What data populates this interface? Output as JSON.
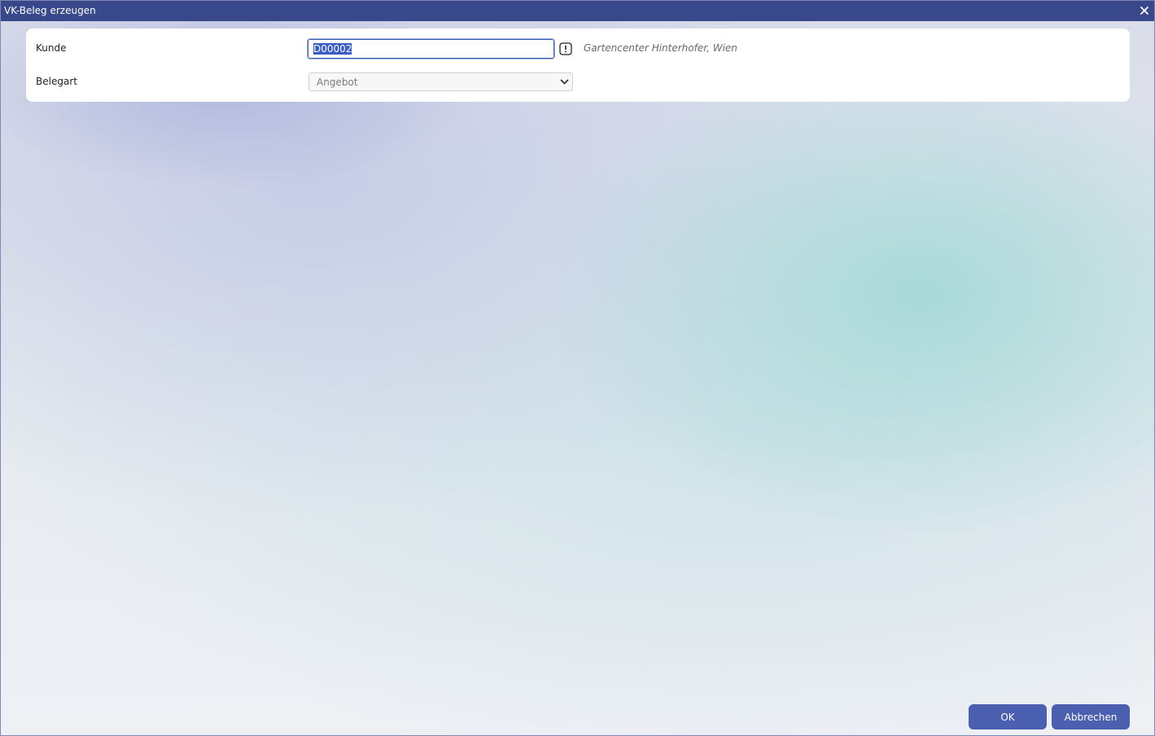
{
  "window": {
    "title": "VK-Beleg erzeugen",
    "close_label": "✕"
  },
  "form": {
    "kunde": {
      "label": "Kunde",
      "value": "D00002",
      "customer_name": "Gartencenter Hinterhofer, Wien",
      "warning_icon": "exclamation-icon"
    },
    "belegart": {
      "label": "Belegart",
      "selected": "Angebot"
    }
  },
  "buttons": {
    "ok": "OK",
    "cancel": "Abbrechen"
  },
  "colors": {
    "titlebar": "#38488a",
    "button": "#4a5fb0",
    "input_focus_border": "#3c5ba8"
  }
}
